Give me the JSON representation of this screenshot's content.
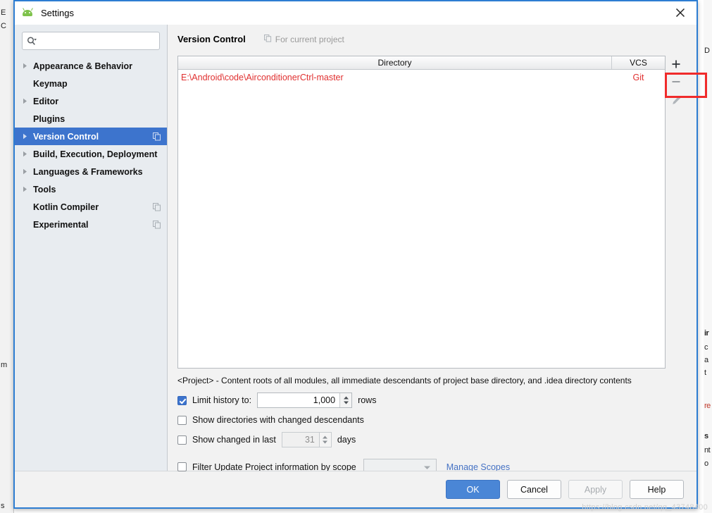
{
  "window": {
    "title": "Settings",
    "app_icon": "android-icon",
    "close_icon": "close-icon"
  },
  "search": {
    "value": "",
    "placeholder": "",
    "icon": "search-icon"
  },
  "sidebar": {
    "items": [
      {
        "label": "Appearance & Behavior",
        "expandable": true,
        "selected": false,
        "copy_icon": false
      },
      {
        "label": "Keymap",
        "expandable": false,
        "selected": false,
        "copy_icon": false
      },
      {
        "label": "Editor",
        "expandable": true,
        "selected": false,
        "copy_icon": false
      },
      {
        "label": "Plugins",
        "expandable": false,
        "selected": false,
        "copy_icon": false
      },
      {
        "label": "Version Control",
        "expandable": true,
        "selected": true,
        "copy_icon": true
      },
      {
        "label": "Build, Execution, Deployment",
        "expandable": true,
        "selected": false,
        "copy_icon": false
      },
      {
        "label": "Languages & Frameworks",
        "expandable": true,
        "selected": false,
        "copy_icon": false
      },
      {
        "label": "Tools",
        "expandable": true,
        "selected": false,
        "copy_icon": false
      },
      {
        "label": "Kotlin Compiler",
        "expandable": false,
        "selected": false,
        "copy_icon": true
      },
      {
        "label": "Experimental",
        "expandable": false,
        "selected": false,
        "copy_icon": true
      }
    ]
  },
  "content": {
    "title": "Version Control",
    "scope_label": "For current project",
    "scope_icon": "copy-icon",
    "table": {
      "columns": [
        "Directory",
        "VCS"
      ],
      "rows": [
        {
          "directory": "E:\\Android\\code\\AirconditionerCtrl-master",
          "vcs": "Git"
        }
      ]
    },
    "side_buttons": [
      {
        "name": "add-directory-button",
        "icon": "plus-icon",
        "highlighted": false
      },
      {
        "name": "remove-directory-button",
        "icon": "minus-icon",
        "highlighted": true
      },
      {
        "name": "edit-directory-button",
        "icon": "pencil-icon",
        "highlighted": false
      }
    ],
    "hint": "<Project> - Content roots of all modules, all immediate descendants of project base directory, and .idea directory contents",
    "options": {
      "limit_history": {
        "label": "Limit history to:",
        "checked": true,
        "value": "1,000",
        "suffix": "rows"
      },
      "show_changed_descendants": {
        "label": "Show directories with changed descendants",
        "checked": false
      },
      "show_changed_in_last": {
        "label": "Show changed in last",
        "checked": false,
        "value": "31",
        "suffix": "days"
      },
      "filter_by_scope": {
        "label": "Filter Update Project information by scope",
        "checked": false,
        "scope_value": "",
        "manage_link": "Manage Scopes"
      }
    }
  },
  "footer": {
    "ok": "OK",
    "cancel": "Cancel",
    "apply": "Apply",
    "help": "Help"
  },
  "watermark": "https://blog.csdn.net/qq_43748400",
  "background": {
    "left_fragments": [
      "E",
      "C",
      "m",
      "s"
    ],
    "right_fragments": [
      "D",
      "ir",
      "c",
      "a",
      "t",
      "re",
      "s",
      "nt",
      "o"
    ]
  },
  "colors": {
    "accent": "#3d74cd",
    "primary_button": "#4a86d6",
    "path_red": "#e03030",
    "highlight_red": "#f02b2b",
    "link_blue": "#4572c4",
    "dialog_border": "#2d7dd2"
  }
}
